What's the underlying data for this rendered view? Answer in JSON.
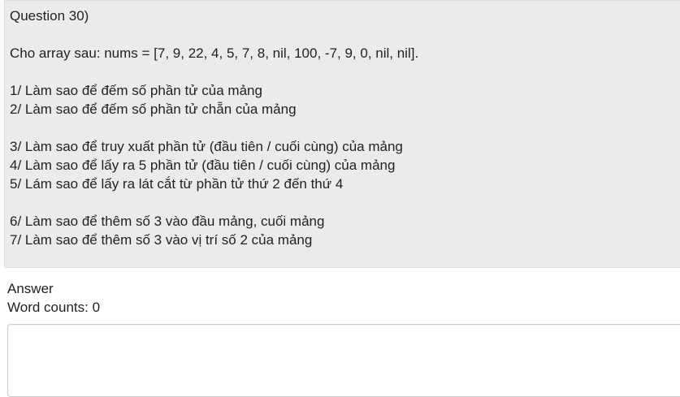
{
  "question": {
    "title": "Question 30)",
    "intro": "Cho array sau: nums = [7, 9, 22, 4, 5, 7, 8, nil, 100, -7, 9, 0, nil, nil].",
    "items": [
      "1/ Làm sao để đếm số phần tử của mảng",
      "2/ Làm sao để đếm số phần tử chẵn của mảng",
      "3/ Làm sao để truy xuất phần tử (đầu tiên / cuối cùng) của mảng",
      "4/ Làm sao để lấy ra 5 phần tử (đầu tiên / cuối cùng) của mảng",
      "5/ Lám sao để lấy ra lát cắt từ phần tử thứ 2 đến thứ 4",
      "6/ Làm sao để thêm số 3 vào đầu mảng, cuối mảng",
      "7/ Làm sao để thêm số 3 vào vị trí số 2 của mảng"
    ]
  },
  "answer": {
    "label": "Answer",
    "word_count_label": "Word counts: 0",
    "value": ""
  }
}
